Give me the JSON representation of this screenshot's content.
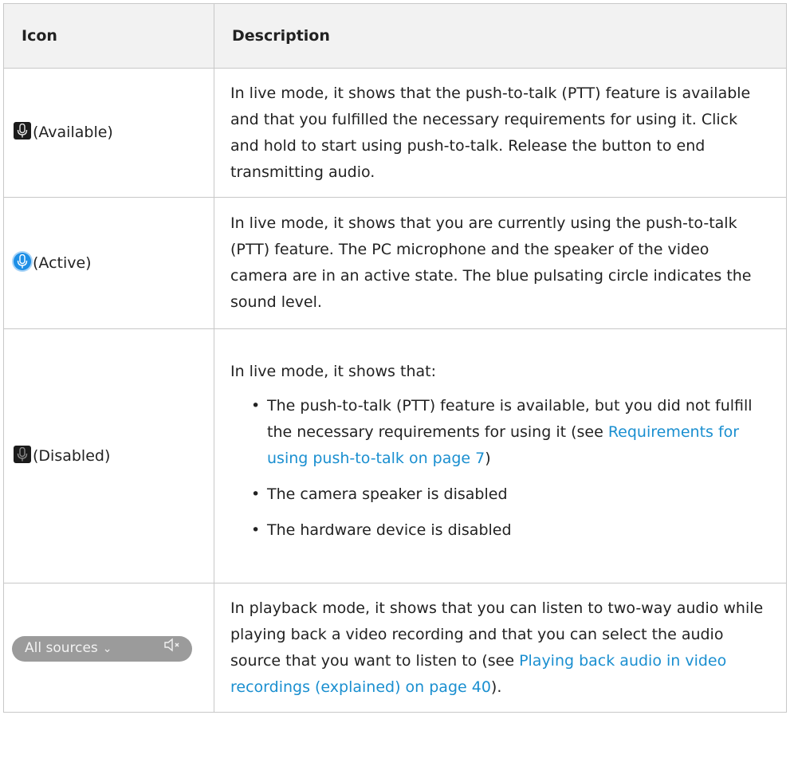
{
  "table": {
    "headers": {
      "icon": "Icon",
      "description": "Description"
    },
    "rows": [
      {
        "state": "(Available)",
        "icon": "microphone-icon",
        "text": "In live mode, it shows that the push-to-talk (PTT) feature is available and that you fulfilled the necessary requirements for using it. Click and hold to start using push-to-talk. Release the button to end transmitting audio."
      },
      {
        "state": "(Active)",
        "icon": "microphone-active-icon",
        "text": "In live mode, it shows that you are currently using the push-to-talk (PTT) feature. The PC microphone and the speaker of the video camera are in an active state. The blue pulsating circle indicates the sound level."
      },
      {
        "state": "(Disabled)",
        "icon": "microphone-disabled-icon",
        "intro": "In live mode, it shows that:",
        "bullets": [
          {
            "before": "The push-to-talk (PTT) feature is available, but you did not fulfill the necessary requirements for using it (see ",
            "link": "Requirements for using push-to-talk on page 7",
            "after": ")"
          },
          {
            "text": "The camera speaker is disabled"
          },
          {
            "text": "The hardware device is disabled"
          }
        ]
      },
      {
        "pill": {
          "label": "All sources",
          "chevron": "chevron-down-icon",
          "speaker": "speaker-muted-icon"
        },
        "before": "In playback mode, it shows that you can listen to two-way audio while playing back a video recording and that you can select the audio source that you want to listen to (see ",
        "link": "Playing back audio in video recordings (explained) on page 40",
        "after": ")."
      }
    ]
  },
  "colors": {
    "link": "#1a8fd0",
    "active_blue": "#1d8fe6",
    "header_bg": "#f2f2f2",
    "border": "#c8c8c8"
  }
}
